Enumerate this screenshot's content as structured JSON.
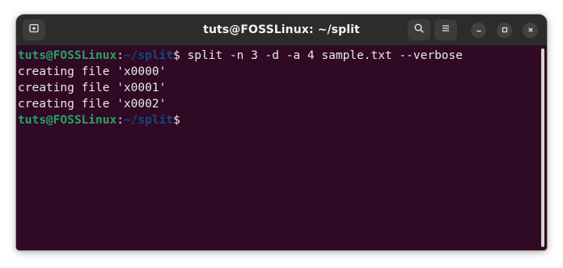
{
  "window": {
    "title": "tuts@FOSSLinux: ~/split"
  },
  "icons": {
    "new_tab": "new-tab-icon",
    "search": "search-icon",
    "menu": "hamburger-menu-icon",
    "minimize": "minimize-icon",
    "maximize": "maximize-icon",
    "close": "close-icon"
  },
  "terminal": {
    "prompt_user": "tuts@FOSSLinux",
    "prompt_colon": ":",
    "prompt_path": "~/split",
    "prompt_symbol": "$",
    "command": " split -n 3 -d -a 4 sample.txt --verbose",
    "output": [
      "creating file 'x0000'",
      "creating file 'x0001'",
      "creating file 'x0002'"
    ]
  },
  "colors": {
    "background": "#300a24",
    "titlebar": "#2c2c2c",
    "prompt_user": "#26a269",
    "prompt_path": "#12488b",
    "text": "#e9e9e9"
  }
}
